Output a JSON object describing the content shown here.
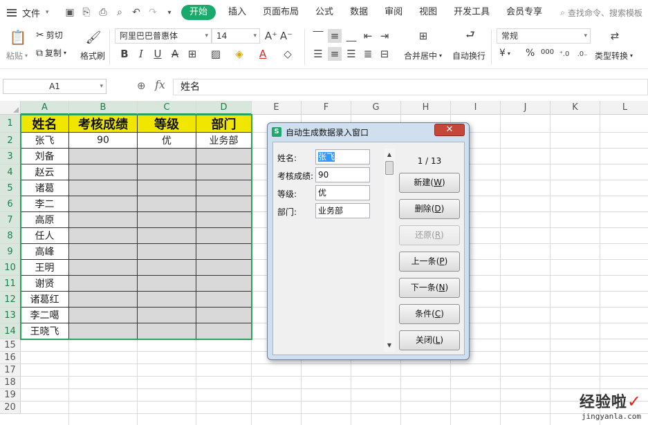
{
  "menubar": {
    "file_label": "文件",
    "tabs": [
      "开始",
      "插入",
      "页面布局",
      "公式",
      "数据",
      "审阅",
      "视图",
      "开发工具",
      "会员专享"
    ],
    "active_tab": "开始",
    "search_placeholder": "查找命令、搜索模板"
  },
  "ribbon": {
    "paste_label": "粘贴",
    "cut_label": "剪切",
    "copy_label": "复制",
    "format_painter_label": "格式刷",
    "font_name": "阿里巴巴普惠体",
    "font_size": "14",
    "merge_label": "合并居中",
    "wrap_label": "自动换行",
    "number_format": "常规",
    "type_convert_label": "类型转换",
    "percent_symbol": "%",
    "thousands_symbol": "000",
    "currency_symbol": "¥"
  },
  "formula_bar": {
    "cell_ref": "A1",
    "fx_label": "fx",
    "value": "姓名"
  },
  "sheet": {
    "columns": [
      "A",
      "B",
      "C",
      "D",
      "E",
      "F",
      "G",
      "H",
      "I",
      "J",
      "K",
      "L"
    ],
    "rows": [
      "1",
      "2",
      "3",
      "4",
      "5",
      "6",
      "7",
      "8",
      "9",
      "10",
      "11",
      "12",
      "13",
      "14",
      "15",
      "16",
      "17",
      "18",
      "19",
      "20"
    ],
    "headers": [
      "姓名",
      "考核成绩",
      "等级",
      "部门"
    ],
    "data": [
      [
        "张飞",
        "90",
        "优",
        "业务部"
      ],
      [
        "刘备",
        "",
        "",
        ""
      ],
      [
        "赵云",
        "",
        "",
        ""
      ],
      [
        "诸葛",
        "",
        "",
        ""
      ],
      [
        "李二",
        "",
        "",
        ""
      ],
      [
        "高原",
        "",
        "",
        ""
      ],
      [
        "任人",
        "",
        "",
        ""
      ],
      [
        "高峰",
        "",
        "",
        ""
      ],
      [
        "王明",
        "",
        "",
        ""
      ],
      [
        "谢贤",
        "",
        "",
        ""
      ],
      [
        "诸葛红",
        "",
        "",
        ""
      ],
      [
        "李二噶",
        "",
        "",
        ""
      ],
      [
        "王晓飞",
        "",
        "",
        ""
      ]
    ],
    "header_color": "#f0e600",
    "empty_cell_color": "#d9d9d9",
    "selection_color": "#2aa05a"
  },
  "dialog": {
    "title": "自动生成数据录入窗口",
    "close_label": "✕",
    "fields": [
      {
        "label": "姓名:",
        "value": "张飞"
      },
      {
        "label": "考核成绩:",
        "value": "90"
      },
      {
        "label": "等级:",
        "value": "优"
      },
      {
        "label": "部门:",
        "value": "业务部"
      }
    ],
    "record_counter": "1 / 13",
    "buttons": [
      {
        "label": "新建",
        "key": "W",
        "enabled": true
      },
      {
        "label": "删除",
        "key": "D",
        "enabled": true
      },
      {
        "label": "还原",
        "key": "R",
        "enabled": false
      },
      {
        "label": "上一条",
        "key": "P",
        "enabled": true
      },
      {
        "label": "下一条",
        "key": "N",
        "enabled": true
      },
      {
        "label": "条件",
        "key": "C",
        "enabled": true
      },
      {
        "label": "关闭",
        "key": "L",
        "enabled": true
      }
    ]
  },
  "watermark": {
    "brand": "经验啦",
    "url": "jingyanla.com"
  }
}
